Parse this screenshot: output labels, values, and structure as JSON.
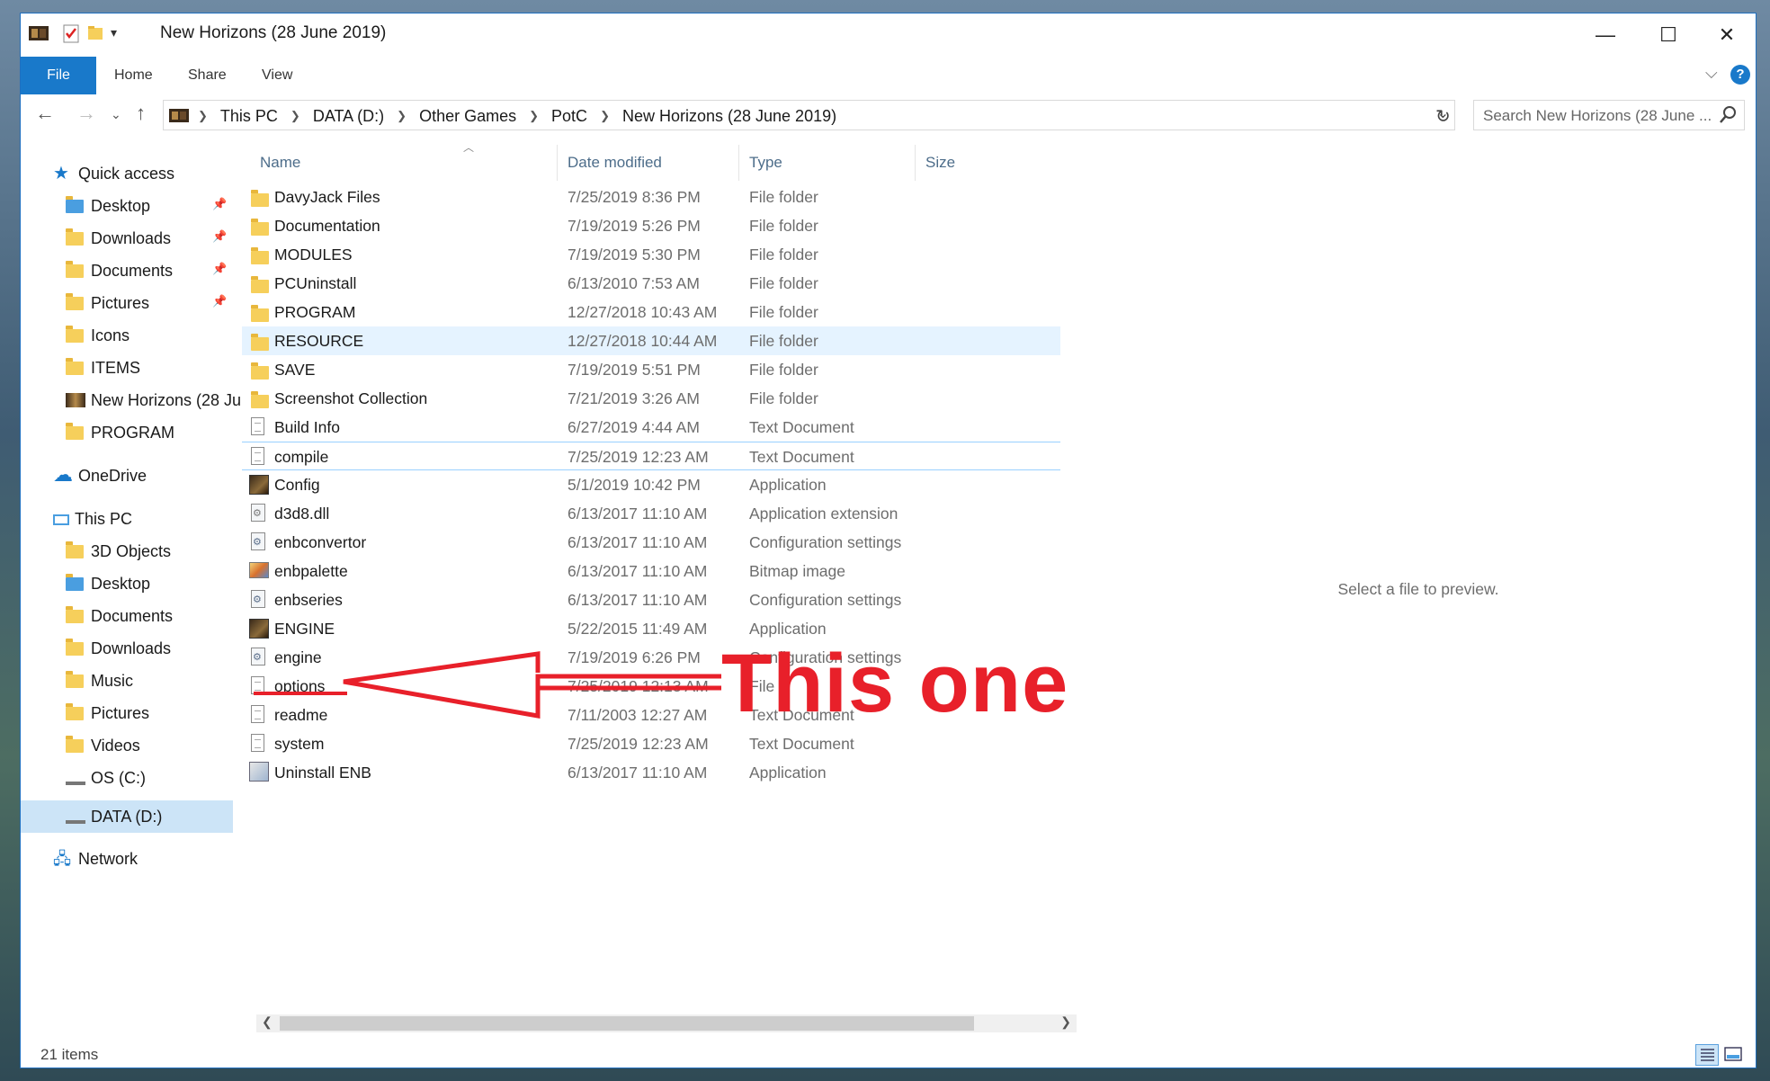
{
  "window": {
    "title": "New Horizons (28 June 2019)",
    "controls": {
      "minimize": "—",
      "maximize": "☐",
      "close": "✕"
    }
  },
  "ribbon": {
    "tabs": [
      "File",
      "Home",
      "Share",
      "View"
    ],
    "help_label": "?"
  },
  "address": {
    "crumbs": [
      "This PC",
      "DATA (D:)",
      "Other Games",
      "PotC",
      "New Horizons (28 June 2019)"
    ]
  },
  "search": {
    "placeholder": "Search New Horizons (28 June ..."
  },
  "sidebar": {
    "quick_access": "Quick access",
    "quick_items": [
      "Desktop",
      "Downloads",
      "Documents",
      "Pictures",
      "Icons",
      "ITEMS",
      "New Horizons (28 Ju",
      "PROGRAM"
    ],
    "onedrive": "OneDrive",
    "this_pc": "This PC",
    "pc_items": [
      "3D Objects",
      "Desktop",
      "Documents",
      "Downloads",
      "Music",
      "Pictures",
      "Videos",
      "OS (C:)",
      "DATA (D:)"
    ],
    "network": "Network"
  },
  "columns": {
    "name": "Name",
    "date": "Date modified",
    "type": "Type",
    "size": "Size"
  },
  "files": [
    {
      "name": "DavyJack Files",
      "date": "7/25/2019 8:36 PM",
      "type": "File folder",
      "icon": "folder"
    },
    {
      "name": "Documentation",
      "date": "7/19/2019 5:26 PM",
      "type": "File folder",
      "icon": "folder"
    },
    {
      "name": "MODULES",
      "date": "7/19/2019 5:30 PM",
      "type": "File folder",
      "icon": "folder"
    },
    {
      "name": "PCUninstall",
      "date": "6/13/2010 7:53 AM",
      "type": "File folder",
      "icon": "folder"
    },
    {
      "name": "PROGRAM",
      "date": "12/27/2018 10:43 AM",
      "type": "File folder",
      "icon": "folder"
    },
    {
      "name": "RESOURCE",
      "date": "12/27/2018 10:44 AM",
      "type": "File folder",
      "icon": "folder"
    },
    {
      "name": "SAVE",
      "date": "7/19/2019 5:51 PM",
      "type": "File folder",
      "icon": "folder"
    },
    {
      "name": "Screenshot Collection",
      "date": "7/21/2019 3:26 AM",
      "type": "File folder",
      "icon": "folder"
    },
    {
      "name": "Build Info",
      "date": "6/27/2019 4:44 AM",
      "type": "Text Document",
      "icon": "text"
    },
    {
      "name": "compile",
      "date": "7/25/2019 12:23 AM",
      "type": "Text Document",
      "icon": "text"
    },
    {
      "name": "Config",
      "date": "5/1/2019 10:42 PM",
      "type": "Application",
      "icon": "app"
    },
    {
      "name": "d3d8.dll",
      "date": "6/13/2017 11:10 AM",
      "type": "Application extension",
      "icon": "dll"
    },
    {
      "name": "enbconvertor",
      "date": "6/13/2017 11:10 AM",
      "type": "Configuration settings",
      "icon": "config"
    },
    {
      "name": "enbpalette",
      "date": "6/13/2017 11:10 AM",
      "type": "Bitmap image",
      "icon": "bitmap"
    },
    {
      "name": "enbseries",
      "date": "6/13/2017 11:10 AM",
      "type": "Configuration settings",
      "icon": "config"
    },
    {
      "name": "ENGINE",
      "date": "5/22/2015 11:49 AM",
      "type": "Application",
      "icon": "app"
    },
    {
      "name": "engine",
      "date": "7/19/2019 6:26 PM",
      "type": "Configuration settings",
      "icon": "config"
    },
    {
      "name": "options",
      "date": "7/25/2019 12:13 AM",
      "type": "File",
      "icon": "text"
    },
    {
      "name": "readme",
      "date": "7/11/2003 12:27 AM",
      "type": "Text Document",
      "icon": "text"
    },
    {
      "name": "system",
      "date": "7/25/2019 12:23 AM",
      "type": "Text Document",
      "icon": "text"
    },
    {
      "name": "Uninstall ENB",
      "date": "6/13/2017 11:10 AM",
      "type": "Application",
      "icon": "uninstall"
    }
  ],
  "preview": {
    "message": "Select a file to preview."
  },
  "status": {
    "item_count": "21 items"
  },
  "annotation": {
    "text": "This one",
    "color": "#e8202a"
  },
  "colors": {
    "accent": "#1979ca",
    "selected_row": "#e5f3ff",
    "nav_selected": "#cce4f7"
  }
}
